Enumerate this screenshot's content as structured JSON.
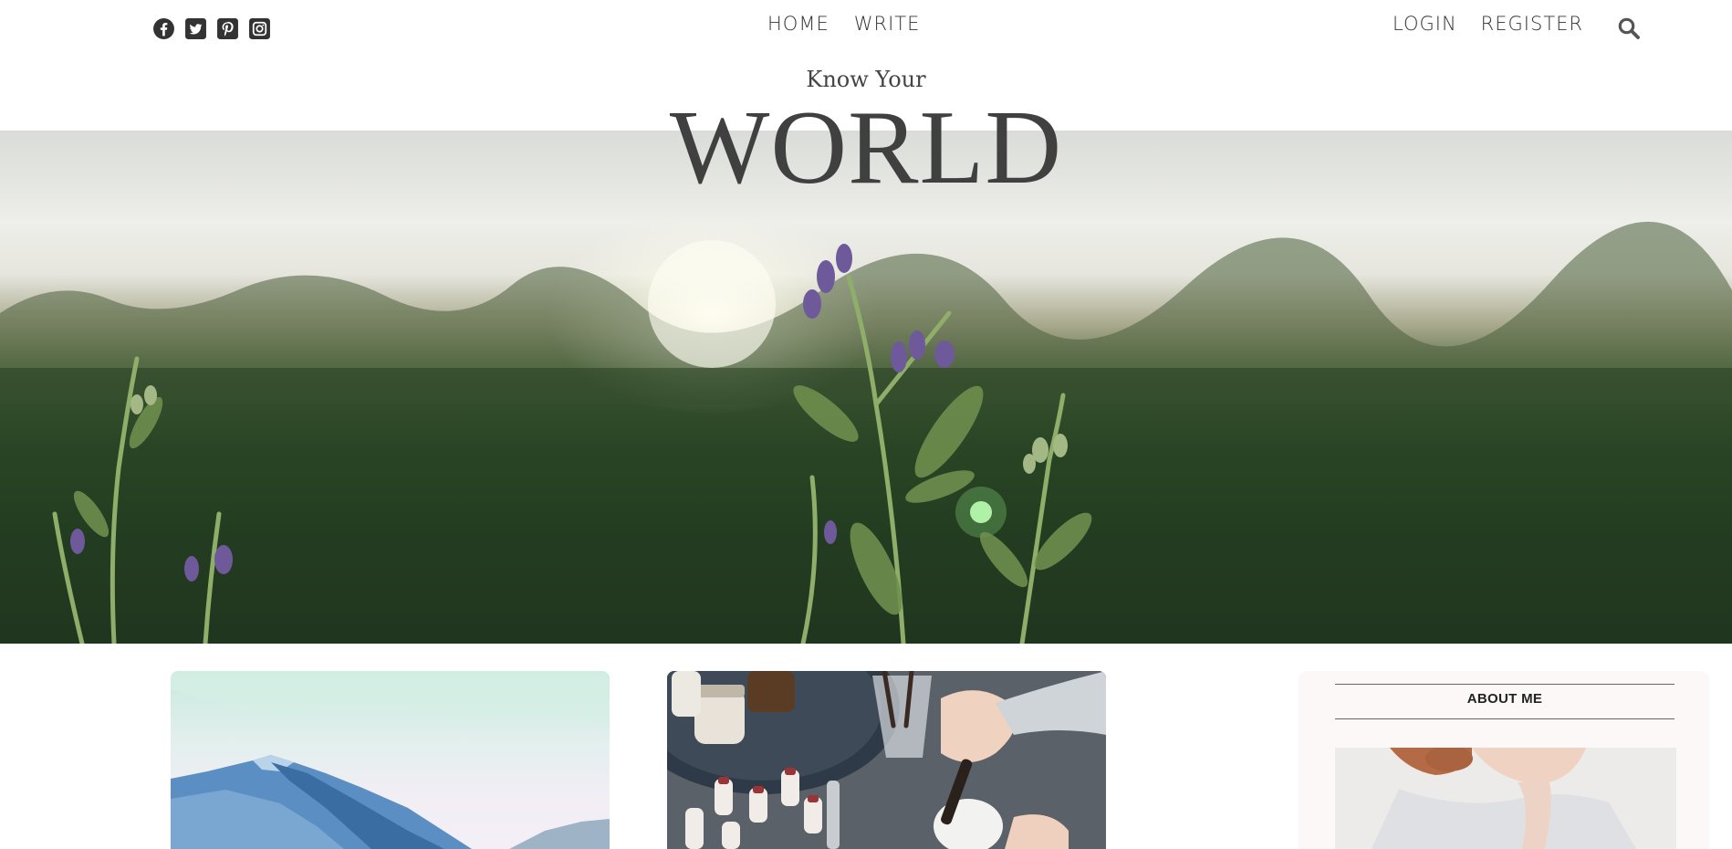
{
  "header": {
    "social_icons": [
      "facebook-icon",
      "twitter-icon",
      "pinterest-icon",
      "instagram-icon"
    ],
    "nav_center": [
      {
        "label": "HOME"
      },
      {
        "label": "WRITE"
      }
    ],
    "nav_right": [
      {
        "label": "LOGIN"
      },
      {
        "label": "REGISTER"
      }
    ],
    "search_icon": "search-icon"
  },
  "hero": {
    "subtitle": "Know Your",
    "title": "WORLD"
  },
  "sidebar": {
    "about_title": "ABOUT ME"
  },
  "colors": {
    "text": "#444444",
    "icon": "#333333",
    "sidebar_bg": "#fcf8f8"
  }
}
